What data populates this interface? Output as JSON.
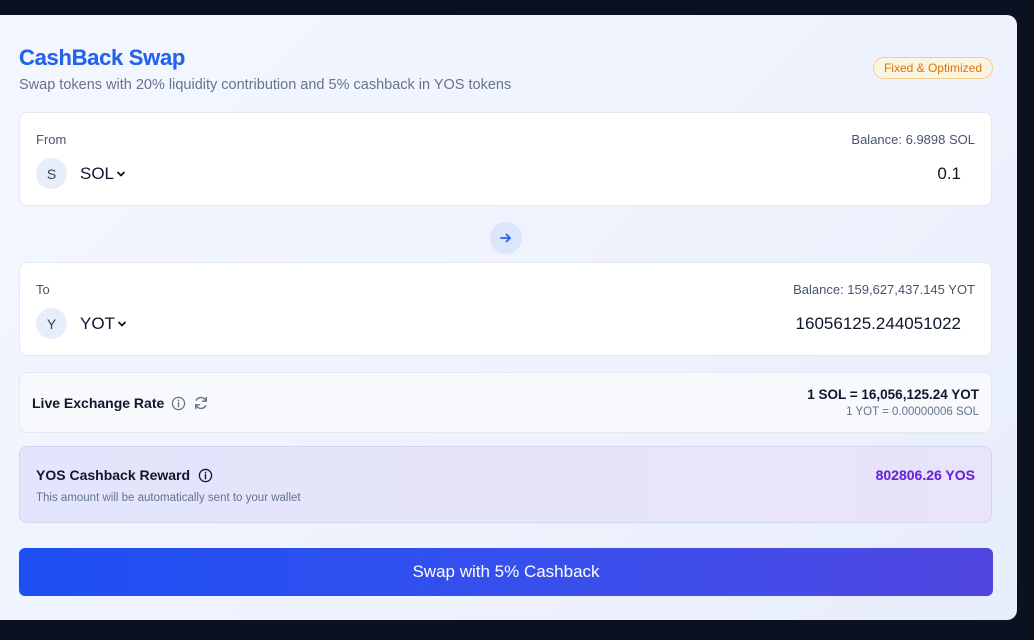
{
  "header": {
    "title": "CashBack Swap",
    "subtitle": "Swap tokens with 20% liquidity contribution and 5% cashback in YOS tokens",
    "badge": "Fixed & Optimized"
  },
  "from": {
    "label": "From",
    "balance": "Balance: 6.9898 SOL",
    "token_initial": "S",
    "token": "SOL",
    "amount": "0.1"
  },
  "to": {
    "label": "To",
    "balance": "Balance: 159,627,437.145 YOT",
    "token_initial": "Y",
    "token": "YOT",
    "amount": "16056125.244051022"
  },
  "rate": {
    "label": "Live Exchange Rate",
    "primary": "1 SOL = 16,056,125.24 YOT",
    "secondary": "1 YOT = 0.00000006 SOL"
  },
  "reward": {
    "title": "YOS Cashback Reward",
    "note": "This amount will be automatically sent to your wallet",
    "amount": "802806.26 YOS"
  },
  "action": {
    "swap_label": "Swap with 5% Cashback"
  },
  "colors": {
    "accent": "#2563eb",
    "badge_text": "#d97706",
    "reward_amount": "#6d28d9",
    "button_start": "#1d4ff5",
    "button_end": "#5146e1"
  }
}
